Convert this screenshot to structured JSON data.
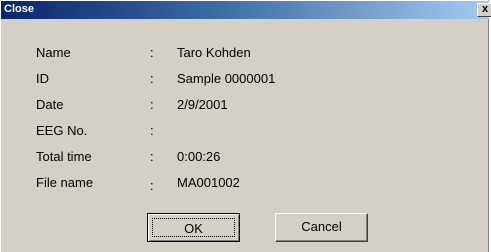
{
  "window": {
    "title": "Close",
    "close_glyph": "x"
  },
  "fields": [
    {
      "label": "Name",
      "sep": ":",
      "value": "Taro Kohden"
    },
    {
      "label": "ID",
      "sep": ":",
      "value": "Sample 0000001"
    },
    {
      "label": "Date",
      "sep": ":",
      "value": "2/9/2001"
    },
    {
      "label": "EEG No.",
      "sep": ":",
      "value": ""
    },
    {
      "label": "Total time",
      "sep": ":",
      "value": "0:00:26"
    },
    {
      "label": "File name",
      "sep": ":",
      "value": "MA001002"
    }
  ],
  "buttons": {
    "ok_label": "OK",
    "cancel_label": "Cancel"
  },
  "colors": {
    "title_bar_start": "#0a246a",
    "title_bar_end": "#a6caf0",
    "dialog_face": "#d4d0c8"
  }
}
